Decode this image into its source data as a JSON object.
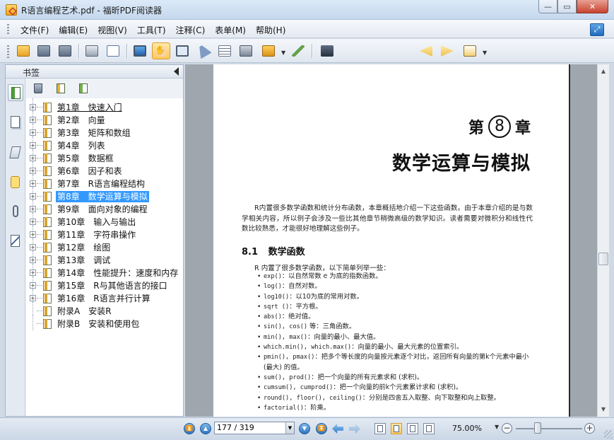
{
  "window": {
    "title": "R语言编程艺术.pdf - 福昕PDF阅读器",
    "minimize": "—",
    "maximize": "▭",
    "close": "✕"
  },
  "menu": {
    "items": [
      "文件(F)",
      "编辑(E)",
      "视图(V)",
      "工具(T)",
      "注释(C)",
      "表单(M)",
      "帮助(H)"
    ]
  },
  "toolbar": {
    "buttons": [
      "open-icon",
      "save-icon",
      "save-as-icon",
      "print-icon",
      "email-icon",
      "fullscreen-icon",
      "hand-tool-icon",
      "zoom-icon",
      "select-arrow-icon",
      "text-select-icon",
      "snapshot-icon",
      "rms-lock-icon",
      "pen-icon",
      "find-binoculars-icon",
      "find-prev-icon",
      "find-next-icon",
      "highlight-icon"
    ],
    "active": "hand-tool-icon",
    "search_value": ""
  },
  "sidebar": {
    "header": "书签",
    "tabs": [
      "bookmark-panel-icon",
      "pages-panel-icon",
      "layers-panel-icon",
      "comments-panel-icon",
      "attachments-panel-icon",
      "signatures-panel-icon"
    ],
    "tool_buttons": [
      "delete-bookmark-icon",
      "add-bookmark-icon",
      "add-child-bookmark-icon"
    ],
    "bookmarks": [
      {
        "label": "第1章　快速入门",
        "expandable": true
      },
      {
        "label": "第2章　向量",
        "expandable": true
      },
      {
        "label": "第3章　矩阵和数组",
        "expandable": true
      },
      {
        "label": "第4章　列表",
        "expandable": true
      },
      {
        "label": "第5章　数据框",
        "expandable": true
      },
      {
        "label": "第6章　因子和表",
        "expandable": true
      },
      {
        "label": "第7章　R语言编程结构",
        "expandable": true
      },
      {
        "label": "第8章　数学运算与模拟",
        "expandable": true,
        "selected": true
      },
      {
        "label": "第9章　面向对象的编程",
        "expandable": true
      },
      {
        "label": "第10章　输入与输出",
        "expandable": true
      },
      {
        "label": "第11章　字符串操作",
        "expandable": true
      },
      {
        "label": "第12章　绘图",
        "expandable": true
      },
      {
        "label": "第13章　调试",
        "expandable": true
      },
      {
        "label": "第14章　性能提升：速度和内存",
        "expandable": true
      },
      {
        "label": "第15章　R与其他语言的接口",
        "expandable": true
      },
      {
        "label": "第16章　R语言并行计算",
        "expandable": true
      },
      {
        "label": "附录A　安装R",
        "expandable": false
      },
      {
        "label": "附录B　安装和使用包",
        "expandable": false
      }
    ]
  },
  "document": {
    "chapter_prefix": "第",
    "chapter_number": "8",
    "chapter_suffix": "章",
    "chapter_title": "数学运算与模拟",
    "intro": "R内置很多数学函数和统计分布函数，本章概括地介绍一下这些函数。由于本章介绍的是与数学相关内容，所以例子会涉及一些比其他章节稍微高级的数学知识。读者需要对微积分和线性代数比较熟悉，才能很好地理解这些例子。",
    "section_number": "8.1",
    "section_title": "数学函数",
    "list_intro": "R 内置了很多数学函数，以下简单列举一些：",
    "functions": [
      {
        "fn": "exp()",
        "desc": "：以自然常数 e 为底的指数函数。"
      },
      {
        "fn": "log()",
        "desc": "：自然对数。"
      },
      {
        "fn": "log10()",
        "desc": "：以10为底的常用对数。"
      },
      {
        "fn": "sqrt ()",
        "desc": "：平方根。"
      },
      {
        "fn": "abs()",
        "desc": "：绝对值。"
      },
      {
        "fn": "sin(), cos()",
        "desc": " 等：三角函数。"
      },
      {
        "fn": "min(), max()",
        "desc": "：向量的最小、最大值。"
      },
      {
        "fn": "which.min(), which.max()",
        "desc": "：向量的最小、最大元素的位置索引。"
      },
      {
        "fn": "pmin(), pmax()",
        "desc": "：把多个等长度的向量按元素逐个对比，返回所有向量的第k个元素中最小 (最大) 的值。"
      },
      {
        "fn": "sum(), prod()",
        "desc": "：把一个向量的所有元素求和 (求积)。"
      },
      {
        "fn": "cumsum(), cumprod()",
        "desc": "：把一个向量的前k个元素累计求和 (求积)。"
      },
      {
        "fn": "round(), floor(), ceiling()",
        "desc": "：分别是四舍五入取整、向下取整和向上取整。"
      },
      {
        "fn": "factorial()",
        "desc": "：阶乘。"
      }
    ]
  },
  "navigation": {
    "page_display": "177 / 319",
    "zoom": "75.00%"
  }
}
